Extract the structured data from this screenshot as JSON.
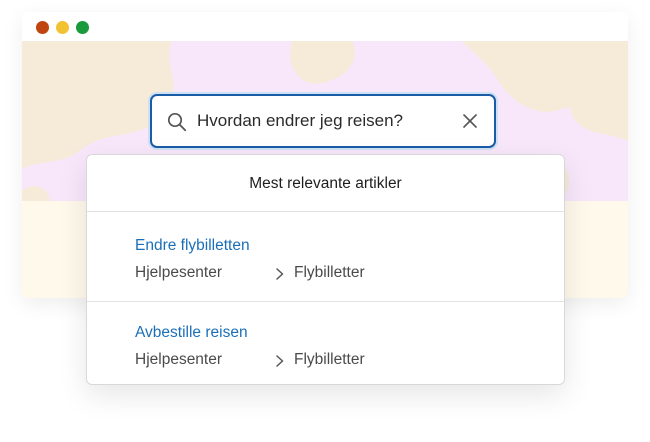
{
  "window": {
    "controls": {
      "close_color": "#c0440f",
      "minimize_color": "#f1c232",
      "maximize_color": "#1a9a3c"
    }
  },
  "theme": {
    "hero_bg": "#f8e7fb",
    "hero_shapes": "#f6ead9",
    "lower_bg": "#fff9ec",
    "accent": "#1a5ca8",
    "link": "#1b6fb8"
  },
  "search": {
    "value": "Hvordan endrer jeg reisen?",
    "search_icon": "search-icon",
    "clear_icon": "close-icon"
  },
  "dropdown": {
    "header": "Mest relevante artikler",
    "results": [
      {
        "title": "Endre flybilletten",
        "breadcrumb": [
          "Hjelpesenter",
          "Flybilletter"
        ]
      },
      {
        "title": "Avbestille reisen",
        "breadcrumb": [
          "Hjelpesenter",
          "Flybilletter"
        ]
      }
    ],
    "separator_icon": "chevron-right-icon"
  }
}
